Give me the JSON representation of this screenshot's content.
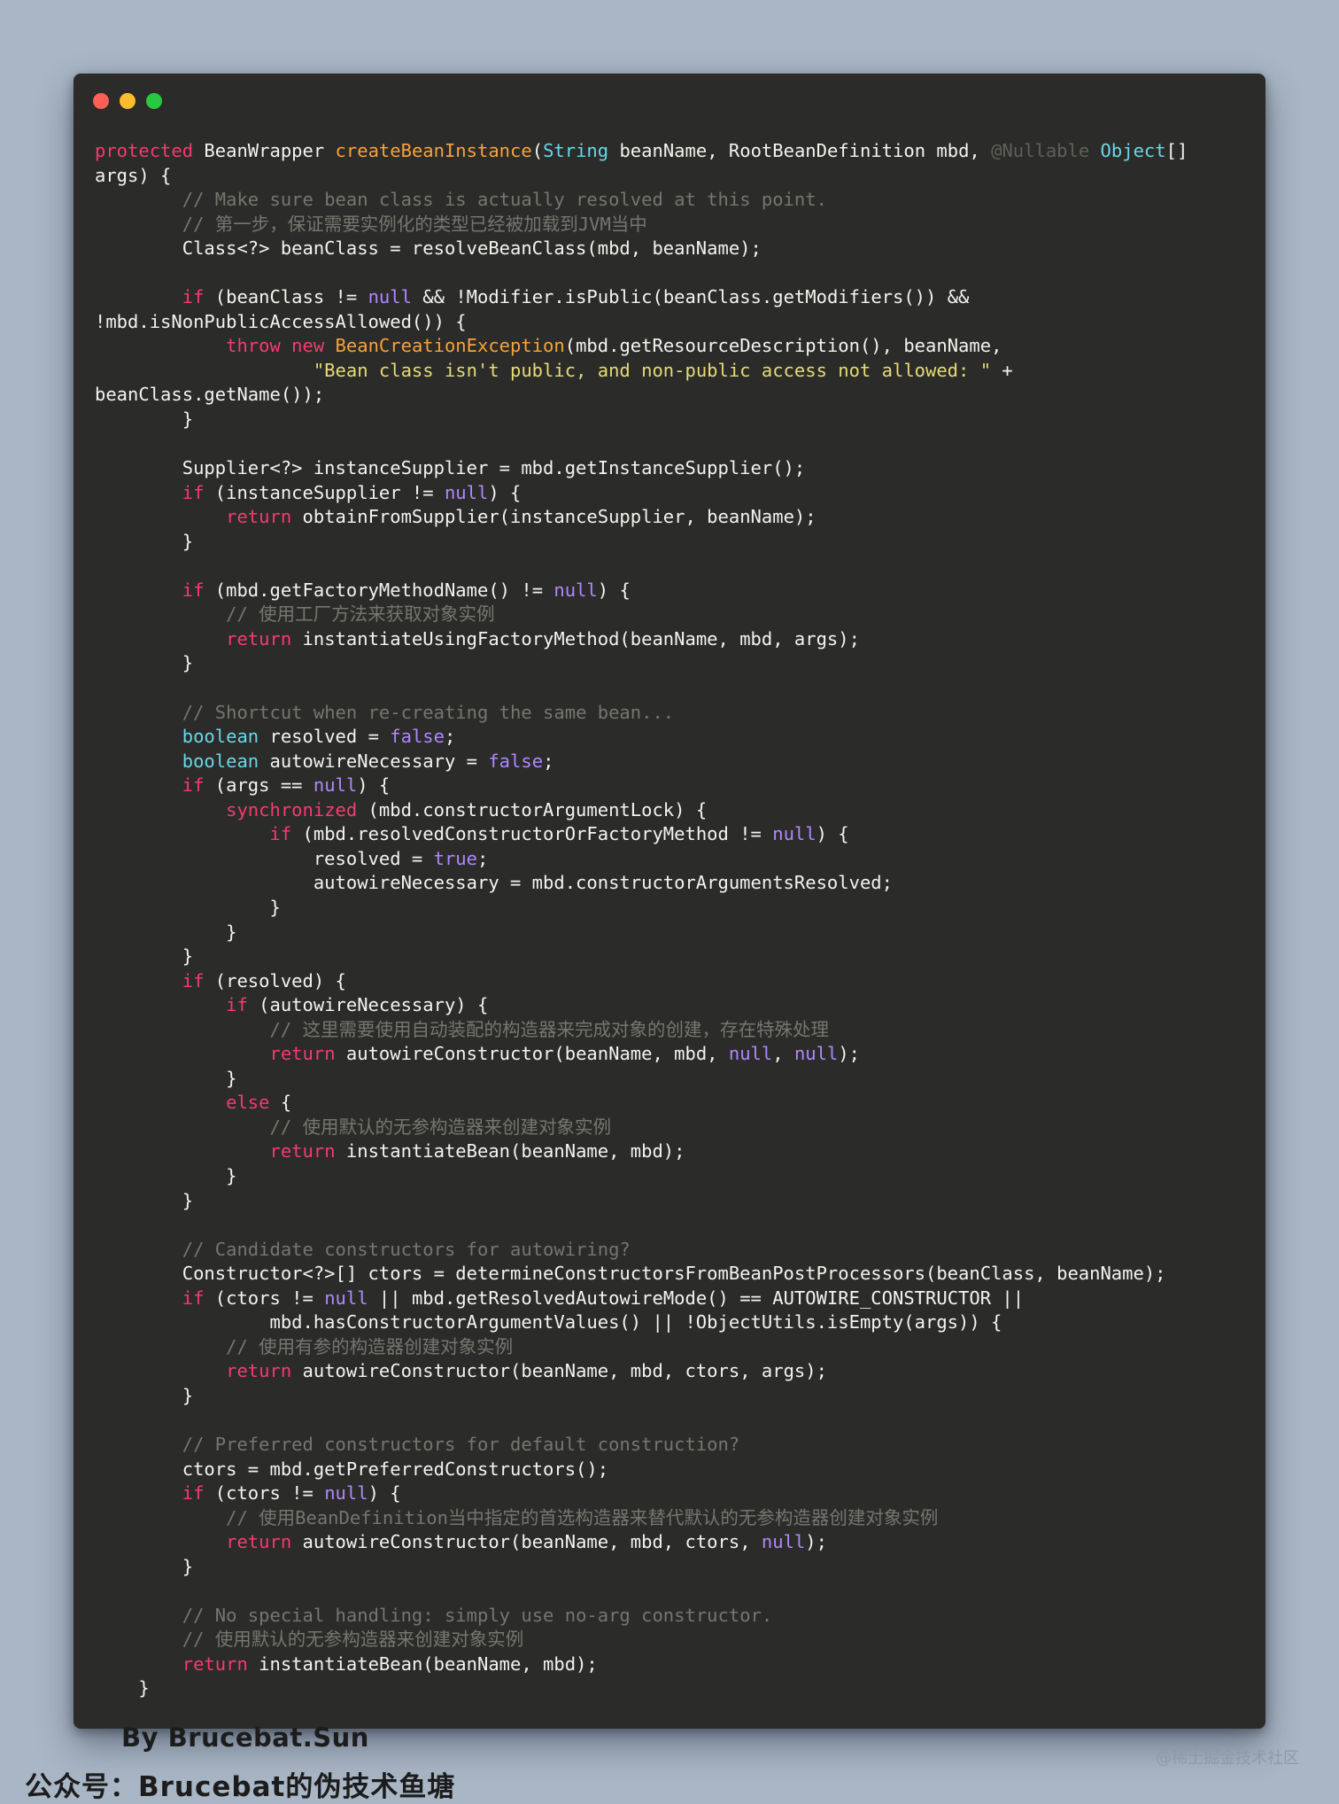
{
  "window": {
    "buttons": [
      {
        "name": "close",
        "color": "#ff5f57"
      },
      {
        "name": "minimize",
        "color": "#febc2e"
      },
      {
        "name": "zoom",
        "color": "#28c840"
      }
    ]
  },
  "colors": {
    "keyword": "#f43b6f",
    "type": "#68d7e8",
    "function": "#f9a23a",
    "literal": "#b087ff",
    "string": "#e6db74",
    "comment": "#767670",
    "plain": "#f3f3ef",
    "background": "#2b2b29"
  },
  "code_lines": [
    [
      [
        "kw",
        "protected"
      ],
      [
        "pl",
        " BeanWrapper "
      ],
      [
        "fn",
        "createBeanInstance"
      ],
      [
        "pl",
        "("
      ],
      [
        "typ",
        "String"
      ],
      [
        "pl",
        " beanName, RootBeanDefinition mbd, "
      ],
      [
        "ann",
        "@Nullable"
      ],
      [
        "pl",
        " "
      ],
      [
        "typ",
        "Object"
      ],
      [
        "pl",
        "[]"
      ]
    ],
    [
      [
        "pl",
        "args) {"
      ]
    ],
    [
      [
        "pl",
        "        "
      ],
      [
        "cmt",
        "// Make sure bean class is actually resolved at this point."
      ]
    ],
    [
      [
        "pl",
        "        "
      ],
      [
        "cmt",
        "// 第一步，保证需要实例化的类型已经被加载到JVM当中"
      ]
    ],
    [
      [
        "pl",
        "        Class<?> beanClass = resolveBeanClass(mbd, beanName);"
      ]
    ],
    [],
    [
      [
        "pl",
        "        "
      ],
      [
        "kw",
        "if"
      ],
      [
        "pl",
        " (beanClass != "
      ],
      [
        "lit",
        "null"
      ],
      [
        "pl",
        " && !Modifier.isPublic(beanClass.getModifiers()) &&"
      ]
    ],
    [
      [
        "pl",
        "!mbd.isNonPublicAccessAllowed()) {"
      ]
    ],
    [
      [
        "pl",
        "            "
      ],
      [
        "kw",
        "throw"
      ],
      [
        "pl",
        " "
      ],
      [
        "kw",
        "new"
      ],
      [
        "pl",
        " "
      ],
      [
        "fn",
        "BeanCreationException"
      ],
      [
        "pl",
        "(mbd.getResourceDescription(), beanName,"
      ]
    ],
    [
      [
        "pl",
        "                    "
      ],
      [
        "str",
        "\"Bean class isn't public, and non-public access not allowed: \""
      ],
      [
        "pl",
        " +"
      ]
    ],
    [
      [
        "pl",
        "beanClass.getName());"
      ]
    ],
    [
      [
        "pl",
        "        }"
      ]
    ],
    [],
    [
      [
        "pl",
        "        Supplier<?> instanceSupplier = mbd.getInstanceSupplier();"
      ]
    ],
    [
      [
        "pl",
        "        "
      ],
      [
        "kw",
        "if"
      ],
      [
        "pl",
        " (instanceSupplier != "
      ],
      [
        "lit",
        "null"
      ],
      [
        "pl",
        ") {"
      ]
    ],
    [
      [
        "pl",
        "            "
      ],
      [
        "kw",
        "return"
      ],
      [
        "pl",
        " obtainFromSupplier(instanceSupplier, beanName);"
      ]
    ],
    [
      [
        "pl",
        "        }"
      ]
    ],
    [],
    [
      [
        "pl",
        "        "
      ],
      [
        "kw",
        "if"
      ],
      [
        "pl",
        " (mbd.getFactoryMethodName() != "
      ],
      [
        "lit",
        "null"
      ],
      [
        "pl",
        ") {"
      ]
    ],
    [
      [
        "pl",
        "            "
      ],
      [
        "cmt",
        "// 使用工厂方法来获取对象实例"
      ]
    ],
    [
      [
        "pl",
        "            "
      ],
      [
        "kw",
        "return"
      ],
      [
        "pl",
        " instantiateUsingFactoryMethod(beanName, mbd, args);"
      ]
    ],
    [
      [
        "pl",
        "        }"
      ]
    ],
    [],
    [
      [
        "pl",
        "        "
      ],
      [
        "cmt",
        "// Shortcut when re-creating the same bean..."
      ]
    ],
    [
      [
        "pl",
        "        "
      ],
      [
        "typ",
        "boolean"
      ],
      [
        "pl",
        " resolved = "
      ],
      [
        "lit",
        "false"
      ],
      [
        "pl",
        ";"
      ]
    ],
    [
      [
        "pl",
        "        "
      ],
      [
        "typ",
        "boolean"
      ],
      [
        "pl",
        " autowireNecessary = "
      ],
      [
        "lit",
        "false"
      ],
      [
        "pl",
        ";"
      ]
    ],
    [
      [
        "pl",
        "        "
      ],
      [
        "kw",
        "if"
      ],
      [
        "pl",
        " (args == "
      ],
      [
        "lit",
        "null"
      ],
      [
        "pl",
        ") {"
      ]
    ],
    [
      [
        "pl",
        "            "
      ],
      [
        "kw",
        "synchronized"
      ],
      [
        "pl",
        " (mbd.constructorArgumentLock) {"
      ]
    ],
    [
      [
        "pl",
        "                "
      ],
      [
        "kw",
        "if"
      ],
      [
        "pl",
        " (mbd.resolvedConstructorOrFactoryMethod != "
      ],
      [
        "lit",
        "null"
      ],
      [
        "pl",
        ") {"
      ]
    ],
    [
      [
        "pl",
        "                    resolved = "
      ],
      [
        "lit",
        "true"
      ],
      [
        "pl",
        ";"
      ]
    ],
    [
      [
        "pl",
        "                    autowireNecessary = mbd.constructorArgumentsResolved;"
      ]
    ],
    [
      [
        "pl",
        "                }"
      ]
    ],
    [
      [
        "pl",
        "            }"
      ]
    ],
    [
      [
        "pl",
        "        }"
      ]
    ],
    [
      [
        "pl",
        "        "
      ],
      [
        "kw",
        "if"
      ],
      [
        "pl",
        " (resolved) {"
      ]
    ],
    [
      [
        "pl",
        "            "
      ],
      [
        "kw",
        "if"
      ],
      [
        "pl",
        " (autowireNecessary) {"
      ]
    ],
    [
      [
        "pl",
        "                "
      ],
      [
        "cmt",
        "// 这里需要使用自动装配的构造器来完成对象的创建，存在特殊处理"
      ]
    ],
    [
      [
        "pl",
        "                "
      ],
      [
        "kw",
        "return"
      ],
      [
        "pl",
        " autowireConstructor(beanName, mbd, "
      ],
      [
        "lit",
        "null"
      ],
      [
        "pl",
        ", "
      ],
      [
        "lit",
        "null"
      ],
      [
        "pl",
        ");"
      ]
    ],
    [
      [
        "pl",
        "            }"
      ]
    ],
    [
      [
        "pl",
        "            "
      ],
      [
        "kw",
        "else"
      ],
      [
        "pl",
        " {"
      ]
    ],
    [
      [
        "pl",
        "                "
      ],
      [
        "cmt",
        "// 使用默认的无参构造器来创建对象实例"
      ]
    ],
    [
      [
        "pl",
        "                "
      ],
      [
        "kw",
        "return"
      ],
      [
        "pl",
        " instantiateBean(beanName, mbd);"
      ]
    ],
    [
      [
        "pl",
        "            }"
      ]
    ],
    [
      [
        "pl",
        "        }"
      ]
    ],
    [],
    [
      [
        "pl",
        "        "
      ],
      [
        "cmt",
        "// Candidate constructors for autowiring?"
      ]
    ],
    [
      [
        "pl",
        "        Constructor<?>[] ctors = determineConstructorsFromBeanPostProcessors(beanClass, beanName);"
      ]
    ],
    [
      [
        "pl",
        "        "
      ],
      [
        "kw",
        "if"
      ],
      [
        "pl",
        " (ctors != "
      ],
      [
        "lit",
        "null"
      ],
      [
        "pl",
        " || mbd.getResolvedAutowireMode() == AUTOWIRE_CONSTRUCTOR ||"
      ]
    ],
    [
      [
        "pl",
        "                mbd.hasConstructorArgumentValues() || !ObjectUtils.isEmpty(args)) {"
      ]
    ],
    [
      [
        "pl",
        "            "
      ],
      [
        "cmt",
        "// 使用有参的构造器创建对象实例"
      ]
    ],
    [
      [
        "pl",
        "            "
      ],
      [
        "kw",
        "return"
      ],
      [
        "pl",
        " autowireConstructor(beanName, mbd, ctors, args);"
      ]
    ],
    [
      [
        "pl",
        "        }"
      ]
    ],
    [],
    [
      [
        "pl",
        "        "
      ],
      [
        "cmt",
        "// Preferred constructors for default construction?"
      ]
    ],
    [
      [
        "pl",
        "        ctors = mbd.getPreferredConstructors();"
      ]
    ],
    [
      [
        "pl",
        "        "
      ],
      [
        "kw",
        "if"
      ],
      [
        "pl",
        " (ctors != "
      ],
      [
        "lit",
        "null"
      ],
      [
        "pl",
        ") {"
      ]
    ],
    [
      [
        "pl",
        "            "
      ],
      [
        "cmt",
        "// 使用BeanDefinition当中指定的首选构造器来替代默认的无参构造器创建对象实例"
      ]
    ],
    [
      [
        "pl",
        "            "
      ],
      [
        "kw",
        "return"
      ],
      [
        "pl",
        " autowireConstructor(beanName, mbd, ctors, "
      ],
      [
        "lit",
        "null"
      ],
      [
        "pl",
        ");"
      ]
    ],
    [
      [
        "pl",
        "        }"
      ]
    ],
    [],
    [
      [
        "pl",
        "        "
      ],
      [
        "cmt",
        "// No special handling: simply use no-arg constructor."
      ]
    ],
    [
      [
        "pl",
        "        "
      ],
      [
        "cmt",
        "// 使用默认的无参构造器来创建对象实例"
      ]
    ],
    [
      [
        "pl",
        "        "
      ],
      [
        "kw",
        "return"
      ],
      [
        "pl",
        " instantiateBean(beanName, mbd);"
      ]
    ],
    [
      [
        "pl",
        "    }"
      ]
    ]
  ],
  "footer": {
    "author": "By Brucebat.Sun",
    "account": "公众号：Brucebat的伪技术鱼塘",
    "watermark": "@稀土掘金技术社区"
  }
}
